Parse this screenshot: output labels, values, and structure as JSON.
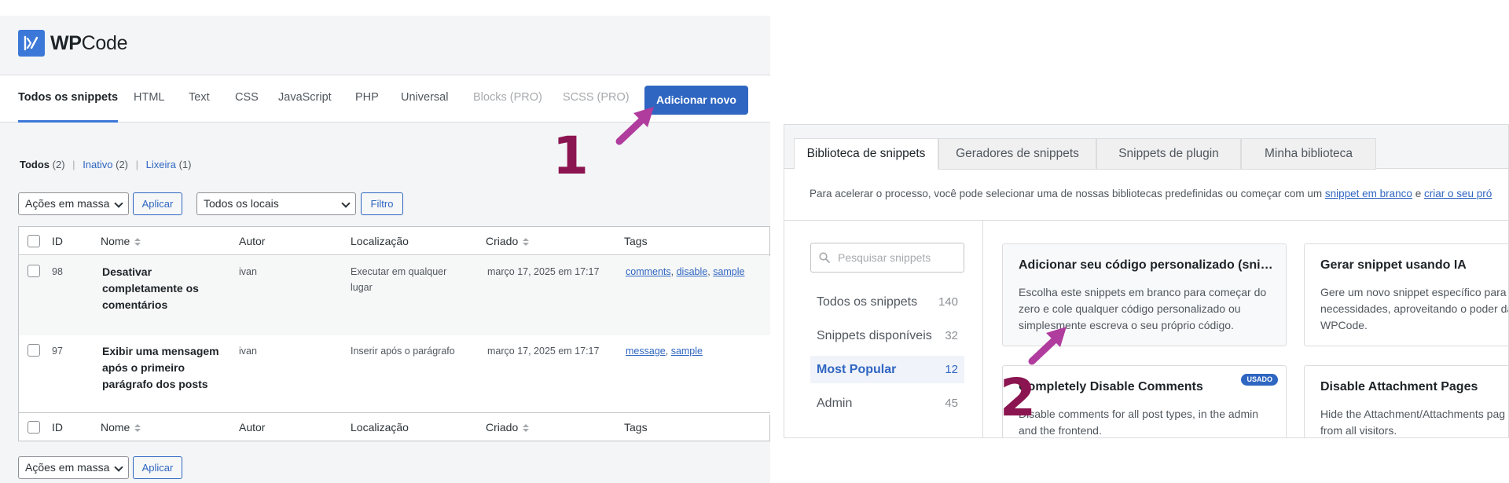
{
  "logo": {
    "brand_bold": "WP",
    "brand_rest": "Code",
    "icon": "wpcode-logo-icon",
    "color": "#3c78d8"
  },
  "left_tabs": [
    {
      "label": "Todos os snippets",
      "state": "active"
    },
    {
      "label": "HTML"
    },
    {
      "label": "Text"
    },
    {
      "label": "CSS"
    },
    {
      "label": "JavaScript"
    },
    {
      "label": "PHP"
    },
    {
      "label": "Universal"
    },
    {
      "label": "Blocks (PRO)",
      "state": "disabled"
    },
    {
      "label": "SCSS (PRO)",
      "state": "disabled"
    }
  ],
  "add_new_label": "Adicionar novo",
  "status_filter": {
    "todos": "Todos",
    "todos_count": "(2)",
    "inativo": "Inativo",
    "inativo_count": "(2)",
    "lixeira": "Lixeira",
    "lixeira_count": "(1)",
    "separator": "|"
  },
  "bulk": {
    "select": "Ações em massa",
    "apply": "Aplicar"
  },
  "location": {
    "select": "Todos os locais",
    "filter": "Filtro"
  },
  "table": {
    "columns": [
      "ID",
      "Nome",
      "Autor",
      "Localização",
      "Criado",
      "Tags"
    ],
    "rows": [
      {
        "id": "98",
        "name": "Desativar completamente os comentários",
        "author": "ivan",
        "location": "Executar em qualquer lugar",
        "created": "março 17, 2025 em 17:17",
        "tags": [
          "comments",
          "disable",
          "sample"
        ]
      },
      {
        "id": "97",
        "name": "Exibir uma mensagem após o primeiro parágrafo dos posts",
        "author": "ivan",
        "location": "Inserir após o parágrafo",
        "created": "março 17, 2025 em 17:17",
        "tags": [
          "message",
          "sample"
        ]
      }
    ]
  },
  "annotations": {
    "step1": "1",
    "step2": "2",
    "arrow_color": "#b03c9e",
    "number_color": "#8b1550"
  },
  "right_tabs": [
    "Biblioteca de snippets",
    "Geradores de snippets",
    "Snippets de plugin",
    "Minha biblioteca"
  ],
  "intro": {
    "text": "Para acelerar o processo, você pode selecionar uma de nossas bibliotecas predefinidas ou começar com um",
    "link1": "snippet em branco",
    "and": "e",
    "link2": "criar o seu pró"
  },
  "search_placeholder": "Pesquisar snippets",
  "categories": [
    {
      "label": "Todos os snippets",
      "count": "140"
    },
    {
      "label": "Snippets disponíveis",
      "count": "32"
    },
    {
      "label": "Most Popular",
      "count": "12",
      "state": "active"
    },
    {
      "label": "Admin",
      "count": "45"
    }
  ],
  "cards": [
    {
      "title": "Adicionar seu código personalizado (sni…",
      "desc": "Escolha este snippets em branco para começar do zero e cole qualquer código personalizado ou simplesmente escreva o seu próprio código."
    },
    {
      "title": "Gerar snippet usando IA",
      "desc": "Gere um novo snippet específico para s necessidades, aproveitando o poder da de IA do WPCode."
    },
    {
      "title": "Completely Disable Comments",
      "badge": "USADO",
      "desc": "Disable comments for all post types, in the admin and the frontend."
    },
    {
      "title": "Disable Attachment Pages",
      "desc": "Hide the Attachment/Attachments pag frontend from all visitors."
    }
  ]
}
